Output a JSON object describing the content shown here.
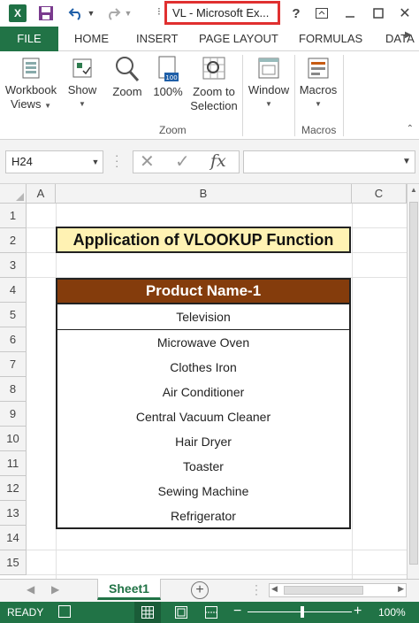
{
  "window": {
    "title": "VL - Microsoft Ex...",
    "app_logo": "X",
    "icons": [
      "excel-logo-icon",
      "save-icon",
      "undo-icon",
      "redo-icon",
      "help-icon",
      "ribbon-display-icon",
      "minimize-icon",
      "maximize-icon",
      "close-icon"
    ]
  },
  "ribbon_tabs": {
    "file": "FILE",
    "home": "HOME",
    "insert": "INSERT",
    "page_layout": "PAGE LAYOUT",
    "formulas": "FORMULAS",
    "data": "DATA"
  },
  "ribbon": {
    "workbook_views": [
      "Workbook",
      "Views"
    ],
    "show": "Show",
    "zoom": "Zoom",
    "zoom_100": "100%",
    "zoom_to_selection": [
      "Zoom to",
      "Selection"
    ],
    "window": "Window",
    "macros": "Macros",
    "group_zoom": "Zoom",
    "group_macros": "Macros"
  },
  "formula_bar": {
    "name_box": "H24",
    "fx": "fx",
    "formula": ""
  },
  "sheet": {
    "columns": [
      "A",
      "B",
      "C"
    ],
    "rows": [
      "1",
      "2",
      "3",
      "4",
      "5",
      "6",
      "7",
      "8",
      "9",
      "10",
      "11",
      "12",
      "13",
      "14",
      "15"
    ],
    "title": "Application of VLOOKUP Function",
    "table_header": "Product Name-1",
    "items": [
      "Television",
      "Microwave Oven",
      "Clothes Iron",
      "Air Conditioner",
      "Central Vacuum Cleaner",
      "Hair Dryer",
      "Toaster",
      "Sewing Machine",
      "Refrigerator"
    ]
  },
  "sheet_tabs": {
    "active": "Sheet1"
  },
  "status": {
    "ready": "READY",
    "zoom": "100%"
  },
  "colors": {
    "excel_green": "#217346",
    "title_fill": "#fff2b3",
    "header_fill": "#843c0c",
    "highlight_border": "#e03030"
  }
}
